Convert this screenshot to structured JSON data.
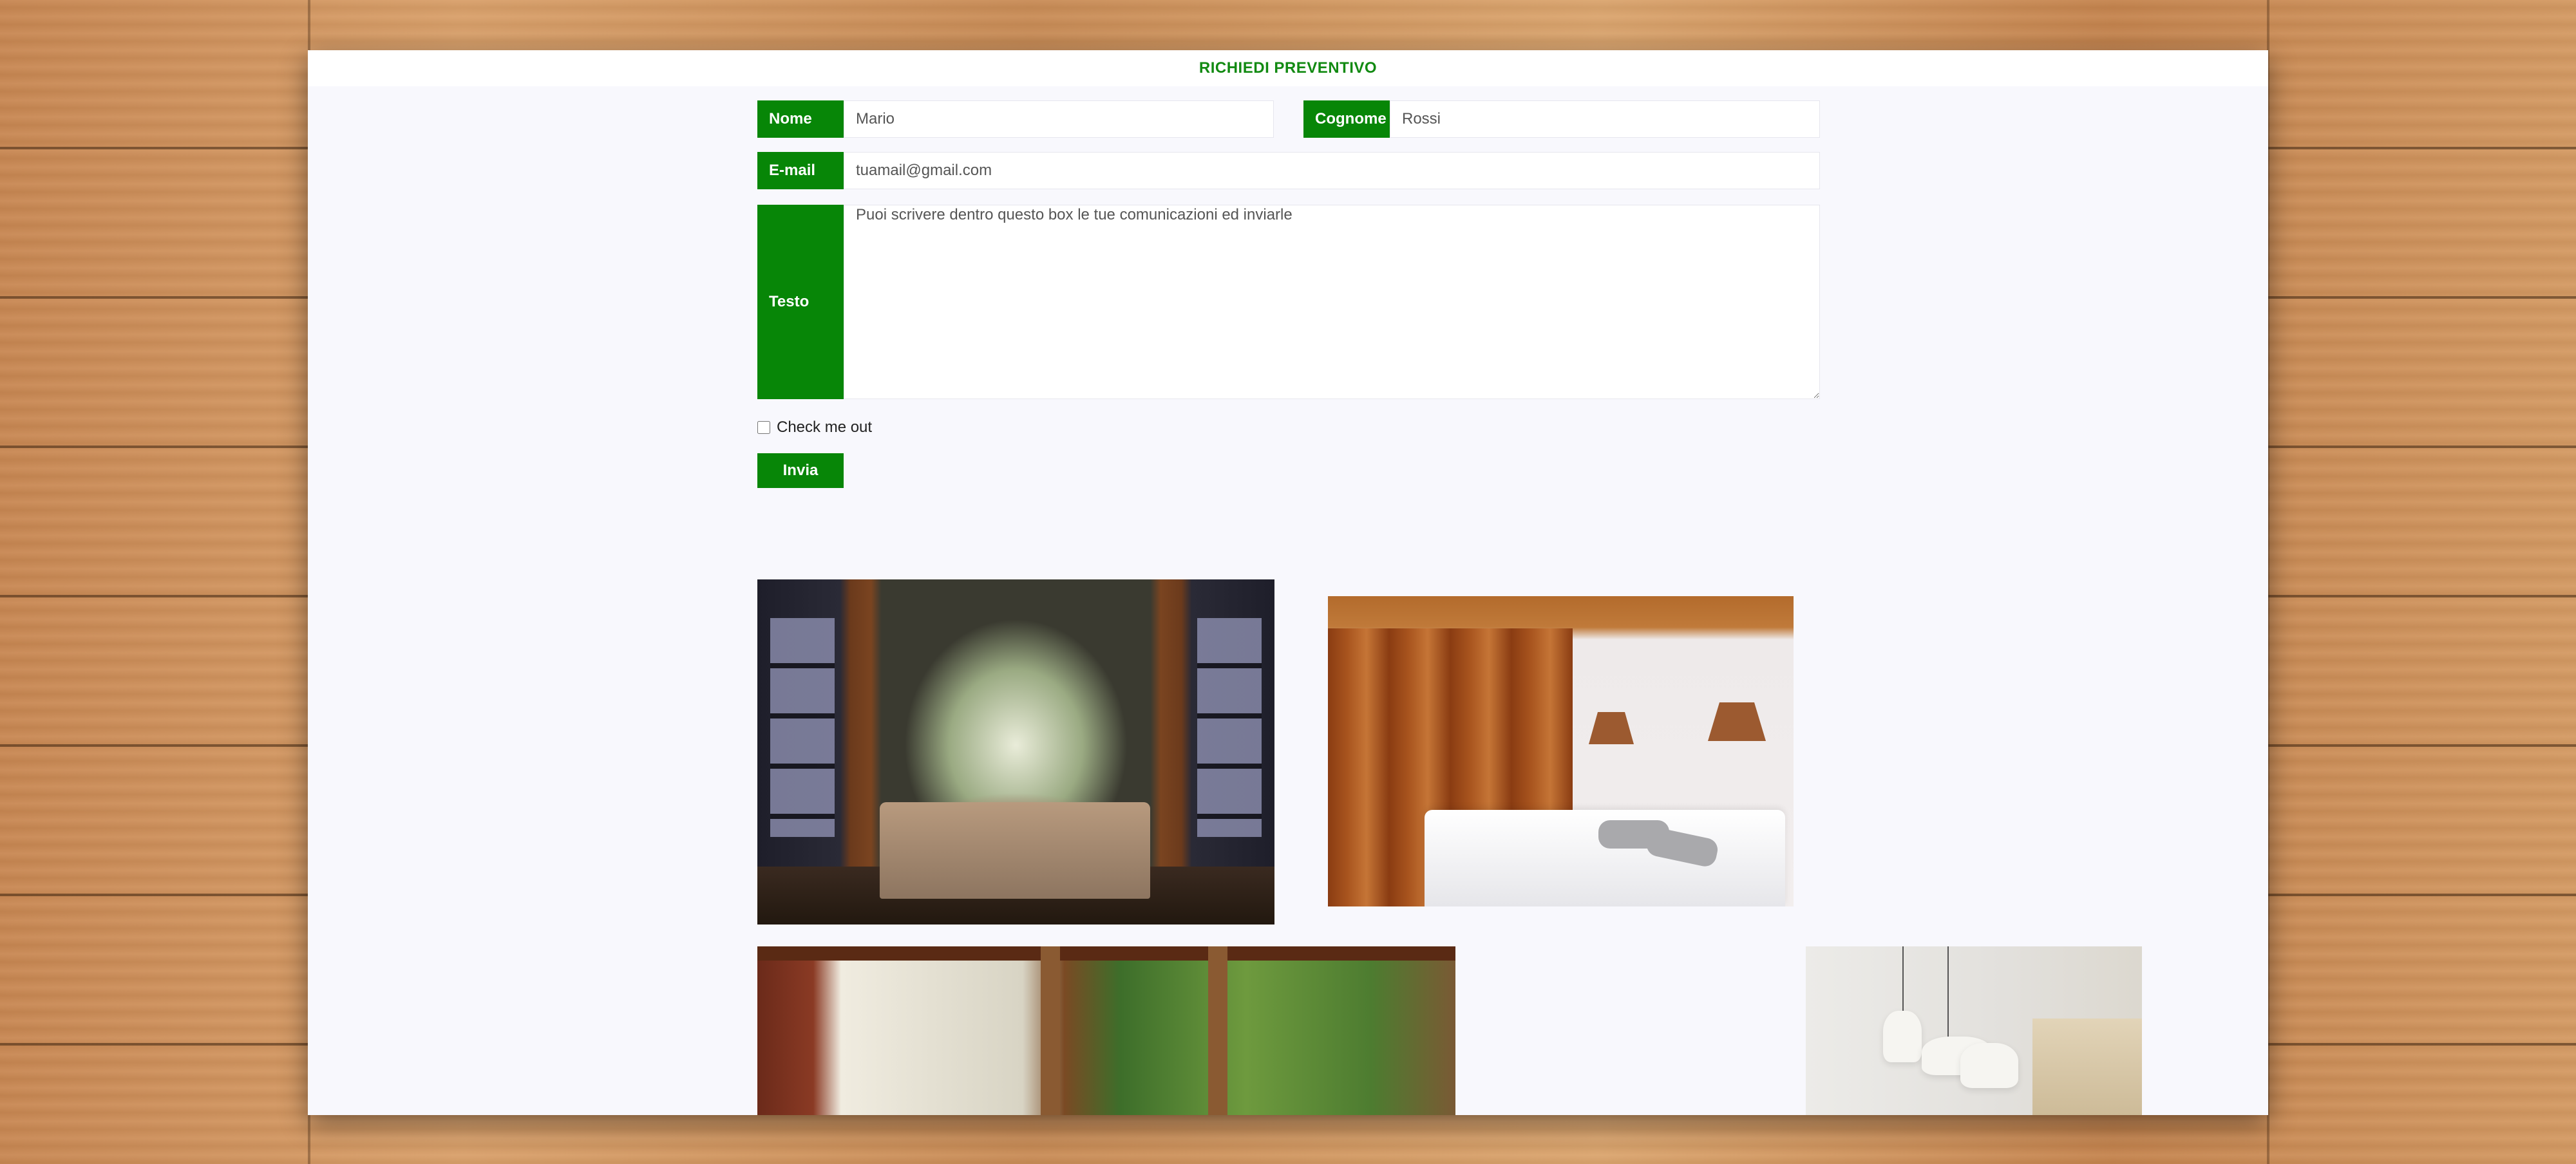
{
  "header": {
    "title": "RICHIEDI PREVENTIVO"
  },
  "form": {
    "nome": {
      "label": "Nome",
      "value": "Mario"
    },
    "cognome": {
      "label": "Cognome",
      "value": "Rossi"
    },
    "email": {
      "label": "E-mail",
      "value": "tuamail@gmail.com"
    },
    "testo": {
      "label": "Testo",
      "value": "Puoi scrivere dentro questo box le tue comunicazioni ed inviarle"
    },
    "checkbox": {
      "label": "Check me out",
      "checked": false
    },
    "submit": {
      "label": "Invia"
    }
  },
  "gallery": [
    {
      "name": "bedroom-canopy-photo"
    },
    {
      "name": "bedroom-white-photo"
    },
    {
      "name": "porch-photo"
    },
    {
      "name": "pendant-lamps-photo"
    }
  ],
  "colors": {
    "accent": "#078607",
    "page_bg": "#f8f8fd",
    "header_text": "#128a12"
  }
}
